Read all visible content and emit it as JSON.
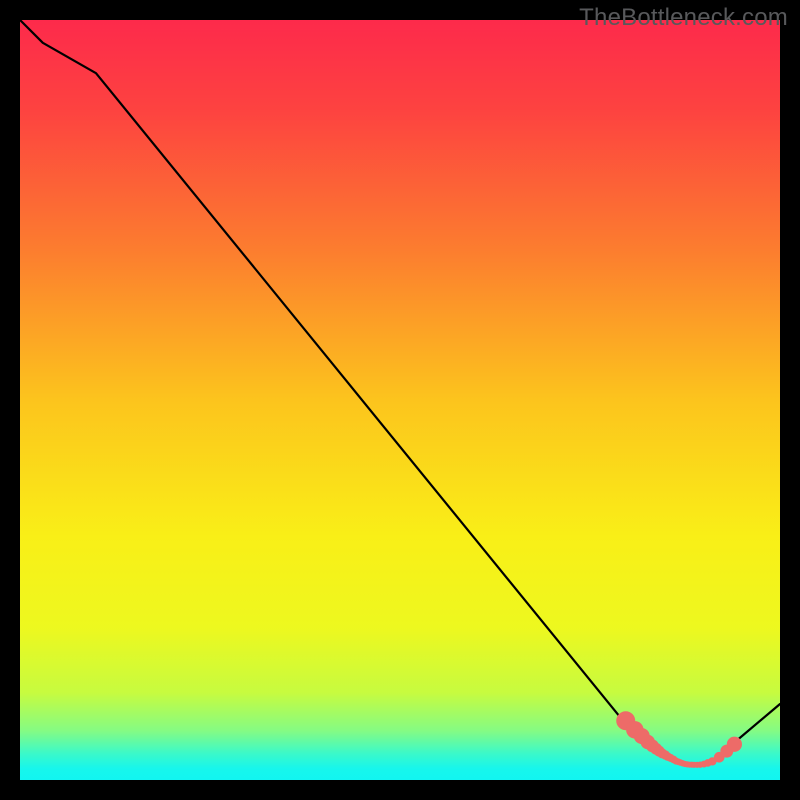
{
  "watermark": "TheBottleneck.com",
  "chart_data": {
    "type": "line",
    "title": "",
    "xlabel": "",
    "ylabel": "",
    "xlim": [
      0,
      100
    ],
    "ylim": [
      0,
      100
    ],
    "grid": false,
    "series": [
      {
        "name": "curve",
        "note": "x is normalized position left→right (0–100), y is normalized height bottom→top (0–100); values read from pixel geometry of the figure",
        "x": [
          0,
          3,
          10,
          80,
          81,
          82.5,
          84,
          85,
          86,
          87,
          88,
          89,
          90,
          91,
          100
        ],
        "y": [
          100,
          97,
          93,
          7,
          5.5,
          4.3,
          3.3,
          2.8,
          2.4,
          2.1,
          2.0,
          2.0,
          2.1,
          2.4,
          10
        ]
      }
    ],
    "markers": {
      "name": "dots",
      "note": "salmon dots along the valley; x/y same normalization; r is relative radius 0–100 scale (≈0.35–1.3)",
      "x": [
        79.7,
        80.9,
        81.8,
        82.6,
        83.2,
        83.7,
        84.1,
        84.5,
        84.9,
        85.2,
        85.6,
        86.0,
        86.3,
        86.6,
        86.9,
        87.2,
        87.5,
        87.8,
        88.1,
        88.4,
        88.7,
        89.1,
        89.5,
        90.0,
        90.5,
        91.1,
        92.0,
        93.0,
        94.0
      ],
      "y": [
        7.8,
        6.6,
        5.8,
        5.0,
        4.5,
        4.1,
        3.8,
        3.5,
        3.3,
        3.1,
        2.9,
        2.7,
        2.5,
        2.4,
        2.3,
        2.2,
        2.1,
        2.05,
        2.02,
        2.01,
        2.0,
        2.0,
        2.02,
        2.1,
        2.25,
        2.45,
        3.0,
        3.8,
        4.7
      ],
      "r": [
        1.25,
        1.15,
        1.05,
        0.95,
        0.85,
        0.78,
        0.72,
        0.66,
        0.61,
        0.57,
        0.53,
        0.5,
        0.47,
        0.45,
        0.43,
        0.42,
        0.41,
        0.41,
        0.4,
        0.4,
        0.4,
        0.4,
        0.42,
        0.45,
        0.5,
        0.55,
        0.7,
        0.85,
        1.0
      ]
    },
    "colors": {
      "curve": "#000000",
      "markers": "#ed6b68",
      "gradient_stops": [
        {
          "offset": 0.0,
          "color": "#fd2a4b"
        },
        {
          "offset": 0.12,
          "color": "#fd4340"
        },
        {
          "offset": 0.3,
          "color": "#fc7c2f"
        },
        {
          "offset": 0.5,
          "color": "#fcc41d"
        },
        {
          "offset": 0.68,
          "color": "#f9ef17"
        },
        {
          "offset": 0.8,
          "color": "#edf81f"
        },
        {
          "offset": 0.885,
          "color": "#c7fb3f"
        },
        {
          "offset": 0.935,
          "color": "#85fb83"
        },
        {
          "offset": 0.965,
          "color": "#3bf9c9"
        },
        {
          "offset": 0.985,
          "color": "#17f6ec"
        },
        {
          "offset": 1.0,
          "color": "#12f5f1"
        }
      ]
    }
  }
}
